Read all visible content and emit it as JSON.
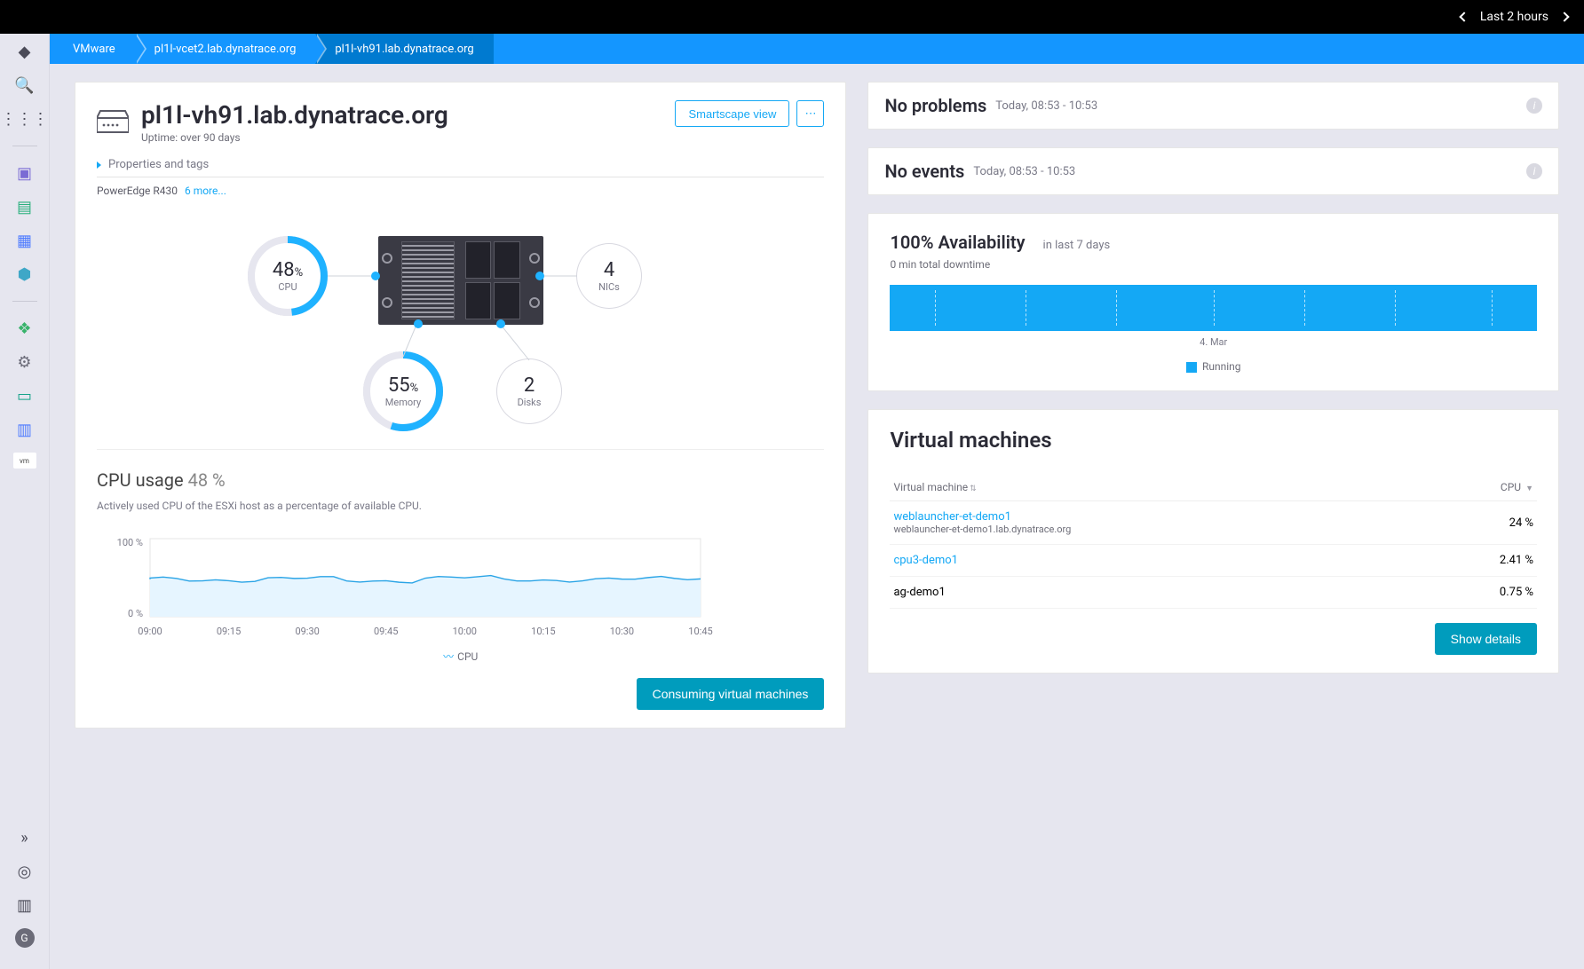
{
  "topbar": {
    "timeframe": "Last 2 hours"
  },
  "breadcrumb": [
    "VMware",
    "pl1l-vcet2.lab.dynatrace.org",
    "pl1l-vh91.lab.dynatrace.org"
  ],
  "header": {
    "title": "pl1l-vh91.lab.dynatrace.org",
    "uptime": "Uptime: over 90 days",
    "smartscape_button": "Smartscape view",
    "menu_button": "⋯"
  },
  "properties": {
    "toggle_label": "Properties and tags",
    "model": "PowerEdge R430",
    "more": "6 more..."
  },
  "infographic": {
    "cpu": {
      "value": "48",
      "unit": "%",
      "label": "CPU"
    },
    "memory": {
      "value": "55",
      "unit": "%",
      "label": "Memory"
    },
    "nics": {
      "value": "4",
      "label": "NICs"
    },
    "disks": {
      "value": "2",
      "label": "Disks"
    }
  },
  "cpu_section": {
    "title_prefix": "CPU usage",
    "title_value": "48 %",
    "description": "Actively used CPU of the ESXi host as a percentage of available CPU.",
    "y_max_label": "100 %",
    "y_min_label": "0 %",
    "legend": "CPU",
    "button": "Consuming virtual machines"
  },
  "problems": {
    "title": "No problems",
    "sub": "Today, 08:53 - 10:53"
  },
  "events": {
    "title": "No events",
    "sub": "Today, 08:53 - 10:53"
  },
  "availability": {
    "title": "100% Availability",
    "range": "in last 7 days",
    "downtime": "0 min total downtime",
    "date_label": "4. Mar",
    "legend": "Running"
  },
  "vm_section": {
    "title": "Virtual machines",
    "col_vm": "Virtual machine",
    "col_cpu": "CPU",
    "rows": [
      {
        "name": "weblauncher-et-demo1",
        "sub": "weblauncher-et-demo1.lab.dynatrace.org",
        "cpu": "24 %",
        "link": true
      },
      {
        "name": "cpu3-demo1",
        "sub": "",
        "cpu": "2.41 %",
        "link": true
      },
      {
        "name": "ag-demo1",
        "sub": "",
        "cpu": "0.75 %",
        "link": false
      }
    ],
    "show_details": "Show details"
  },
  "chart_data": {
    "type": "line",
    "xlabel": "",
    "ylabel": "",
    "ylim": [
      0,
      100
    ],
    "x_ticks": [
      "09:00",
      "09:15",
      "09:30",
      "09:45",
      "10:00",
      "10:15",
      "10:30",
      "10:45"
    ],
    "series": [
      {
        "name": "CPU",
        "x": [
          "09:00",
          "09:15",
          "09:30",
          "09:45",
          "10:00",
          "10:15",
          "10:30",
          "10:45"
        ],
        "values": [
          48,
          47,
          49,
          46,
          50,
          47,
          48,
          49
        ]
      }
    ]
  }
}
